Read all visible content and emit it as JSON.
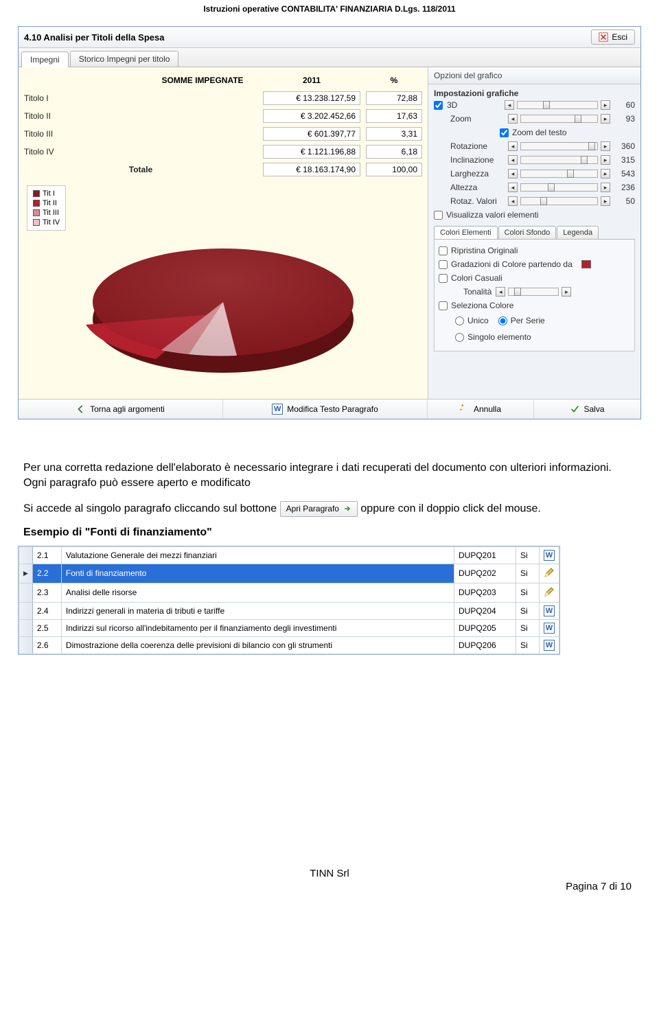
{
  "page_header": "Istruzioni operative CONTABILITA' FINANZIARIA D.Lgs. 118/2011",
  "window": {
    "title": "4.10 Analisi per Titoli della Spesa",
    "esci": "Esci",
    "tabs": [
      "Impegni",
      "Storico Impegni per titolo"
    ],
    "table": {
      "header_somme": "SOMME IMPEGNATE",
      "header_year": "2011",
      "header_pct": "%",
      "rows": [
        {
          "label": "Titolo I",
          "value": "€ 13.238.127,59",
          "pct": "72,88"
        },
        {
          "label": "Titolo II",
          "value": "€ 3.202.452,66",
          "pct": "17,63"
        },
        {
          "label": "Titolo III",
          "value": "€ 601.397,77",
          "pct": "3,31"
        },
        {
          "label": "Titolo IV",
          "value": "€ 1.121.196,88",
          "pct": "6,18"
        }
      ],
      "total_label": "Totale",
      "total_value": "€ 18.163.174,90",
      "total_pct": "100,00"
    },
    "legend": [
      "Tit I",
      "Tit II",
      "Tit III",
      "Tit IV"
    ],
    "bottom": {
      "torna": "Torna agli argomenti",
      "modifica": "Modifica Testo Paragrafo",
      "annulla": "Annulla",
      "salva": "Salva"
    },
    "options": {
      "panel_title": "Opzioni del grafico",
      "panel_sub": "Impostazioni grafiche",
      "d3": "3D",
      "zoom": "Zoom",
      "zoom_testo": "Zoom del testo",
      "rotazione": "Rotazione",
      "inclinazione": "Inclinazione",
      "larghezza": "Larghezza",
      "altezza": "Altezza",
      "rotaz_valori": "Rotaz. Valori",
      "visualizza_valori": "Visualizza valori elementi",
      "vals": {
        "d3": "60",
        "zoom": "93",
        "rotazione": "360",
        "inclinazione": "315",
        "larghezza": "543",
        "altezza": "236",
        "rotaz_valori": "50"
      },
      "inner_tabs": [
        "Colori Elementi",
        "Colori Sfondo",
        "Legenda"
      ],
      "colors": {
        "ripristina": "Ripristina Originali",
        "gradazioni": "Gradazioni di Colore partendo da",
        "casuali": "Colori Casuali",
        "tonalita": "Tonalità",
        "seleziona": "Seleziona Colore",
        "unico": "Unico",
        "per_serie": "Per Serie",
        "singolo": "Singolo elemento"
      }
    }
  },
  "chart_data": {
    "type": "pie",
    "title": "SOMME IMPEGNATE 2011",
    "categories": [
      "Tit I",
      "Tit II",
      "Tit III",
      "Tit IV"
    ],
    "values": [
      72.88,
      17.63,
      3.31,
      6.18
    ],
    "colors": [
      "#8d1a1f",
      "#b4202d",
      "#d98c92",
      "#e9c3c6"
    ]
  },
  "body": {
    "p1a": "Per una corretta redazione dell'elaborato è necessario integrare i dati recuperati del documento con ulteriori informazioni.  Ogni paragrafo può essere aperto e modificato",
    "p2a": "Si accede al singolo paragrafo cliccando sul bottone ",
    "apri_paragrafo": "Apri Paragrafo",
    "p2b": " oppure con il doppio click del mouse.",
    "example_heading": "Esempio di \"Fonti di finanziamento\""
  },
  "grid": {
    "rows": [
      {
        "n": "2.1",
        "desc": "Valutazione Generale dei mezzi finanziari",
        "code": "DUPQ201",
        "si": "Si",
        "icon": "w"
      },
      {
        "n": "2.2",
        "desc": "Fonti di finanziamento",
        "code": "DUPQ202",
        "si": "Si",
        "icon": "pencil",
        "selected": true
      },
      {
        "n": "2.3",
        "desc": "Analisi delle risorse",
        "code": "DUPQ203",
        "si": "Si",
        "icon": "pencil"
      },
      {
        "n": "2.4",
        "desc": "Indirizzi generali in materia di tributi e tariffe",
        "code": "DUPQ204",
        "si": "Si",
        "icon": "w"
      },
      {
        "n": "2.5",
        "desc": "Indirizzi sul ricorso all'indebitamento per il finanziamento degli investimenti",
        "code": "DUPQ205",
        "si": "Si",
        "icon": "w"
      },
      {
        "n": "2.6",
        "desc": "Dimostrazione della coerenza delle previsioni di bilancio con gli strumenti",
        "code": "DUPQ206",
        "si": "Si",
        "icon": "w"
      }
    ]
  },
  "footer": {
    "company": "TINN  Srl",
    "page": "Pagina 7 di 10"
  }
}
